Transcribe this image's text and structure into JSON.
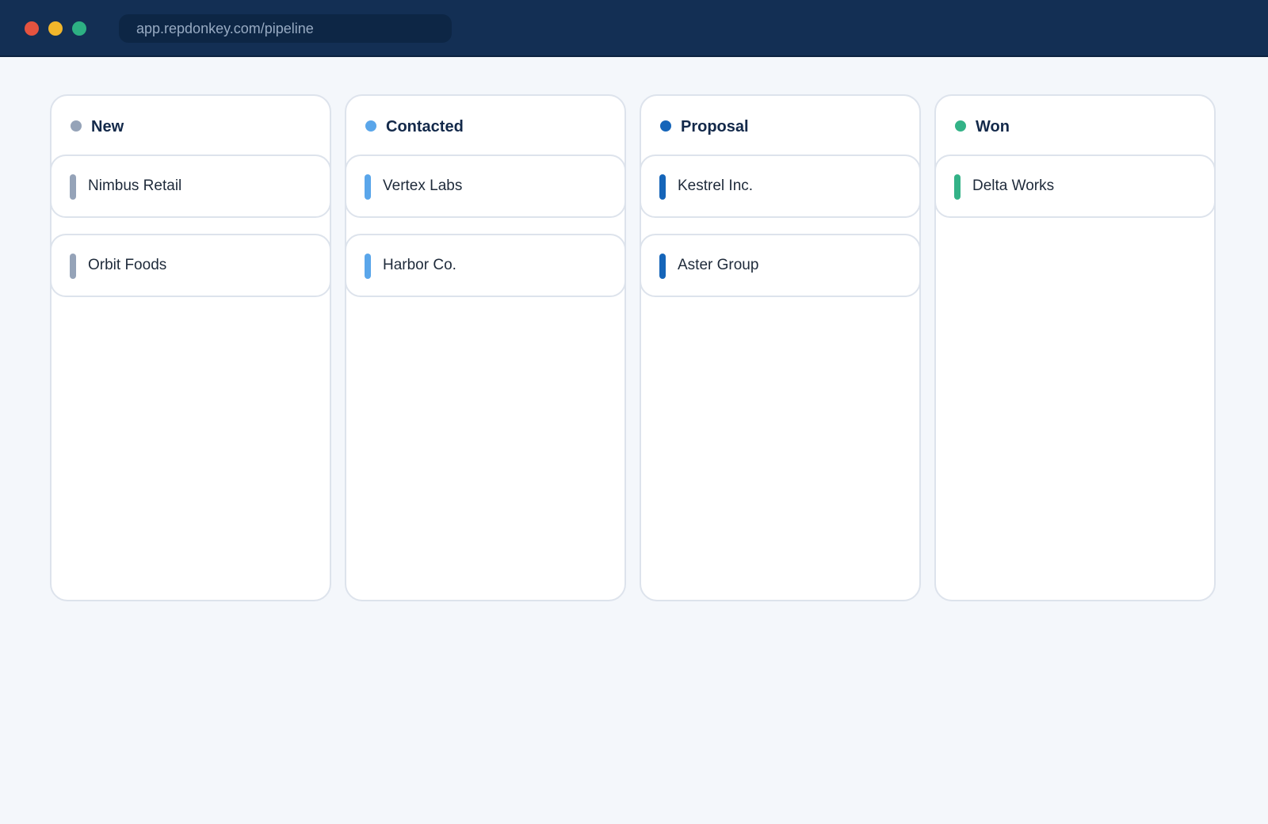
{
  "window": {
    "url": "app.repdonkey.com/pipeline"
  },
  "colors": {
    "topbar": "#132f54",
    "background": "#f4f7fb",
    "traffic_red": "#e5533f",
    "traffic_yellow": "#f1b62b",
    "traffic_green": "#2db083"
  },
  "board": {
    "columns": [
      {
        "title": "New",
        "color": "#95a3b8",
        "cards": [
          "Nimbus Retail",
          "Orbit Foods"
        ]
      },
      {
        "title": "Contacted",
        "color": "#5aa6ea",
        "cards": [
          "Vertex Labs",
          "Harbor Co."
        ]
      },
      {
        "title": "Proposal",
        "color": "#1565b9",
        "cards": [
          "Kestrel Inc.",
          "Aster Group"
        ]
      },
      {
        "title": "Won",
        "color": "#33b287",
        "cards": [
          "Delta Works"
        ]
      }
    ]
  }
}
